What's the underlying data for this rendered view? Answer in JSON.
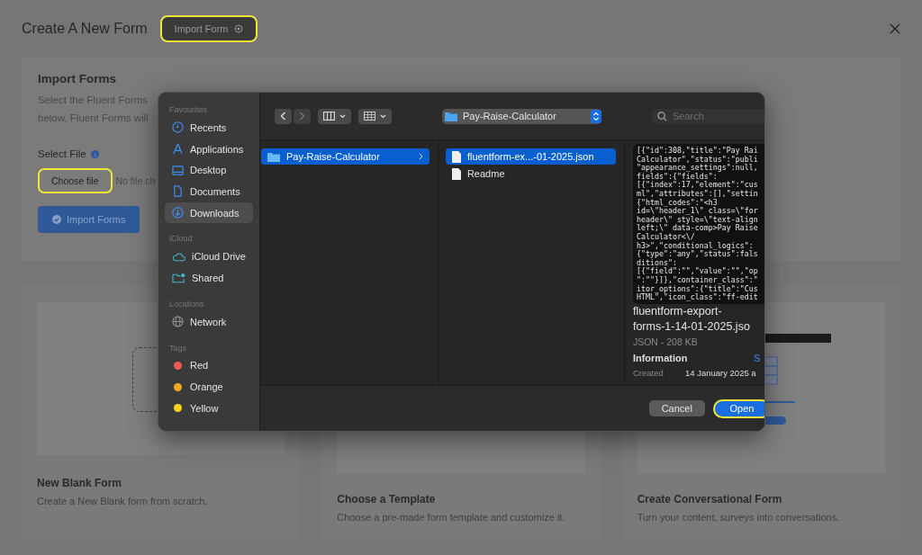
{
  "page": {
    "title": "Create A New Form",
    "import_button": {
      "label": "Import Form",
      "highlighted": true
    }
  },
  "import_panel": {
    "title": "Import Forms",
    "description_lines": [
      "Select the Fluent Forms",
      "below, Fluent Forms will"
    ],
    "select_label": "Select File",
    "choose_button": {
      "label": "Choose file",
      "highlighted": true
    },
    "file_status": "No file ch",
    "submit_label": "Import Forms"
  },
  "cards": [
    {
      "kind": "blank",
      "title": "New Blank Form",
      "description": "Create a New Blank form from scratch."
    },
    {
      "kind": "template",
      "title": "Choose a Template",
      "description": "Choose a pre-made form template and customize it."
    },
    {
      "kind": "conversational",
      "title": "Create Conversational Form",
      "description": "Turn your content, surveys into conversations."
    }
  ],
  "dialog": {
    "sidebar": [
      {
        "heading": "Favourites",
        "items": [
          {
            "label": "Recents",
            "selected": false
          },
          {
            "label": "Applications",
            "selected": false
          },
          {
            "label": "Desktop",
            "selected": false
          },
          {
            "label": "Documents",
            "selected": false
          },
          {
            "label": "Downloads",
            "selected": true
          }
        ]
      },
      {
        "heading": "iCloud",
        "items": [
          {
            "label": "iCloud Drive",
            "selected": false
          },
          {
            "label": "Shared",
            "selected": false
          }
        ]
      },
      {
        "heading": "Locations",
        "items": [
          {
            "label": "Network",
            "selected": false
          }
        ]
      },
      {
        "heading": "Tags",
        "items": [
          {
            "label": "Red",
            "color": "#ec5c57",
            "selected": false
          },
          {
            "label": "Orange",
            "color": "#f5a623",
            "selected": false
          },
          {
            "label": "Yellow",
            "color": "#f7d51d",
            "selected": false
          }
        ]
      }
    ],
    "location": "Pay-Raise-Calculator",
    "search_placeholder": "Search",
    "column_1": [
      {
        "label": "Pay-Raise-Calculator",
        "kind": "folder",
        "selected": true
      }
    ],
    "column_2": [
      {
        "label": "fluentform-ex...-01-2025.json",
        "kind": "file",
        "selected": true
      },
      {
        "label": "Readme",
        "kind": "file",
        "selected": false
      }
    ],
    "preview": {
      "code_lines": [
        "[{\"id\":308,\"title\":\"Pay Rai",
        "Calculator\",\"status\":\"publi",
        "\"appearance_settings\":null,",
        "fields\":{\"fields\":",
        "[{\"index\":17,\"element\":\"cus",
        "ml\",\"attributes\":[],\"settin",
        "{\"html_codes\":\"<h3",
        "id=\\\"header_1\\\" class=\\\"for",
        "header\\\" style=\\\"text-align",
        "left;\\\" data-comp>Pay Raise",
        "Calculator<\\/",
        "h3>\",\"conditional_logics\":",
        "{\"type\":\"any\",\"status\":fals",
        "ditions\":",
        "[{\"field\":\"\",\"value\":\"\",\"op",
        "\":\"\"}]},\"container_class\":\"",
        "itor_options\":{\"title\":\"Cus",
        "HTML\",\"icon_class\":\"ff-edit"
      ],
      "name_lines": [
        "fluentform-export-",
        "forms-1-14-01-2025.jso"
      ],
      "type_size": "JSON - 208 KB",
      "info_heading": "Information",
      "info_link": "S",
      "created_label": "Created",
      "created_value": "14 January 2025 a"
    },
    "cancel_label": "Cancel",
    "open_button": {
      "label": "Open",
      "highlighted": true
    }
  }
}
